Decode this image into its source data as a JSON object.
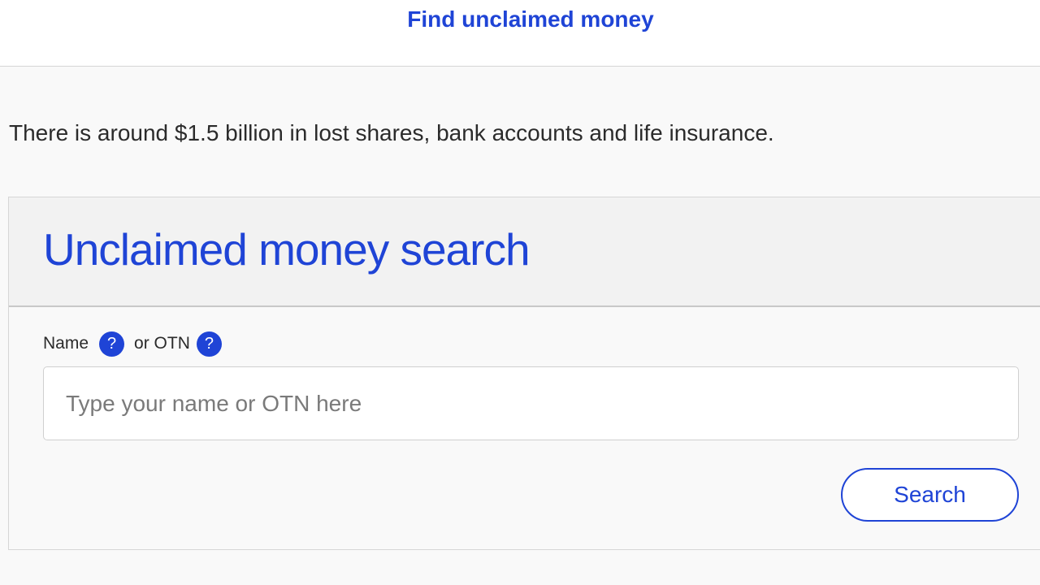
{
  "header": {
    "title": "Find unclaimed money"
  },
  "intro": {
    "text": "There is around $1.5 billion in lost shares, bank accounts and life insurance."
  },
  "search_panel": {
    "title": "Unclaimed money search",
    "label_name": "Name",
    "label_or_otn": "or OTN",
    "help_icon_glyph": "?",
    "input_value": "",
    "input_placeholder": "Type your name or OTN here",
    "search_button_label": "Search"
  },
  "colors": {
    "accent": "#1f44d6",
    "text": "#2b2b2b",
    "page_background": "#f9f9f9",
    "panel_header_background": "#f2f2f2"
  },
  "icons": [
    "name-help-icon",
    "otn-help-icon"
  ]
}
